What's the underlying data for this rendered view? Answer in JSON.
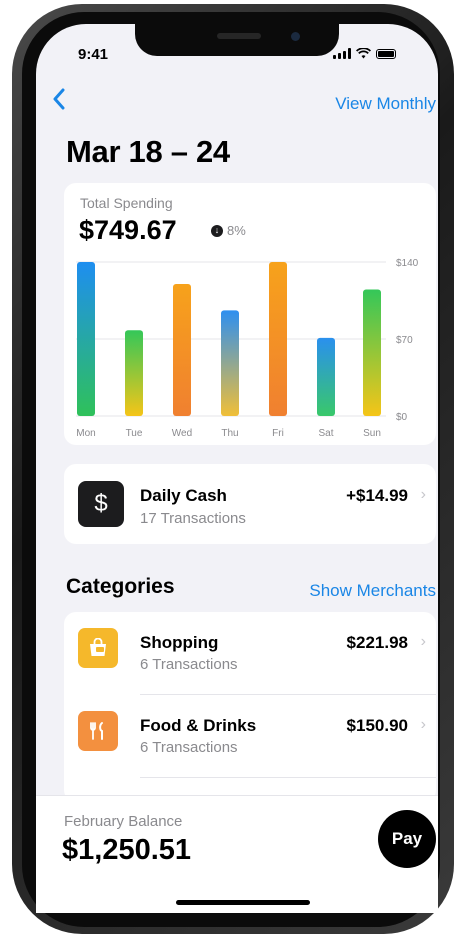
{
  "status_bar": {
    "time": "9:41"
  },
  "nav": {
    "back_icon": "chevron-left-icon",
    "view_monthly": "View Monthly"
  },
  "page_title": "Mar 18 – 24",
  "spending": {
    "label": "Total Spending",
    "amount": "$749.67",
    "change": "8%",
    "change_icon": "arrow-down-circle-icon"
  },
  "chart_data": {
    "type": "bar",
    "categories": [
      "Mon",
      "Tue",
      "Wed",
      "Thu",
      "Fri",
      "Sat",
      "Sun"
    ],
    "values": [
      140,
      78,
      120,
      96,
      140,
      71,
      115
    ],
    "y_ticks": [
      "$140",
      "$70",
      "$0"
    ],
    "ylim": [
      0,
      140
    ],
    "grid": true,
    "colors": {
      "blue_green": [
        "#1e8ef0",
        "#2fc15a"
      ],
      "green_yellow": [
        "#34c759",
        "#f5c518"
      ],
      "orange": [
        "#f7a21b",
        "#f08030"
      ],
      "blue_yellow": [
        "#2e8ff0",
        "#f1bf37"
      ],
      "green_blue": [
        "#2a90ee",
        "#39c86a"
      ]
    }
  },
  "daily_cash": {
    "icon": "dollar-sign-icon",
    "symbol": "$",
    "title": "Daily Cash",
    "subtitle": "17 Transactions",
    "amount": "+$14.99"
  },
  "categories": {
    "header": "Categories",
    "show_merchants": "Show Merchants",
    "items": [
      {
        "icon": "shopping-bag-icon",
        "color": "#f5b82b",
        "title": "Shopping",
        "subtitle": "6 Transactions",
        "amount": "$221.98"
      },
      {
        "icon": "fork-knife-icon",
        "color": "#f3903f",
        "title": "Food & Drinks",
        "subtitle": "6 Transactions",
        "amount": "$150.90"
      }
    ]
  },
  "balance": {
    "label": "February Balance",
    "amount": "$1,250.51",
    "pay_label": "Pay"
  }
}
